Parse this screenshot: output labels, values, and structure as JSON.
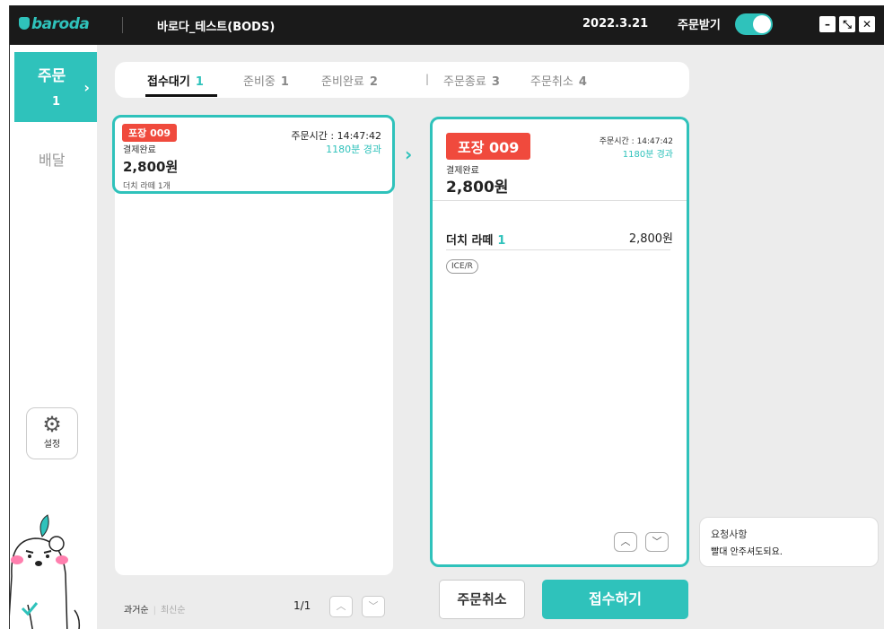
{
  "titlebar": {
    "logo": "baroda",
    "store_name": "바로다_테스트(BODS)",
    "date": "2022.3.21",
    "receive_label": "주문받기",
    "receive_on": true,
    "controls": [
      "minimize-icon",
      "restore-icon",
      "close-icon"
    ]
  },
  "sidebar": {
    "order_label": "주문",
    "order_count": "1",
    "delivery_label": "배달",
    "settings_label": "설정",
    "settings_icon": "gear-icon"
  },
  "tabs": [
    {
      "label": "접수대기",
      "count": "1",
      "active": true
    },
    {
      "label": "준비중",
      "count": "1",
      "active": false
    },
    {
      "label": "준비완료",
      "count": "2",
      "active": false
    },
    {
      "label": "주문종료",
      "count": "3",
      "active": false
    },
    {
      "label": "주문취소",
      "count": "4",
      "active": false
    }
  ],
  "order_card": {
    "badge": "포장 009",
    "status": "결제완료",
    "price": "2,800원",
    "item_summary": "더치 라떼 1개",
    "time": "주문시간 : 14:47:42",
    "elapsed": "1180분 경과"
  },
  "detail": {
    "badge": "포장 009",
    "time": "주문시간 : 14:47:42",
    "elapsed": "1180분 경과",
    "status": "결제완료",
    "price": "2,800원",
    "item_name": "더치 라떼",
    "item_qty": "1",
    "item_price": "2,800원",
    "option": "ICE/R"
  },
  "request": {
    "title": "요청사항",
    "text": "빨대 안주셔도되요."
  },
  "footer": {
    "sort_past": "과거순",
    "sort_recent": "최신순",
    "page": "1/1",
    "cancel_label": "주문취소",
    "accept_label": "접수하기"
  },
  "colors": {
    "accent": "#2fc2bb",
    "badge": "#f04a3d",
    "titlebar": "#1a1a1a"
  }
}
